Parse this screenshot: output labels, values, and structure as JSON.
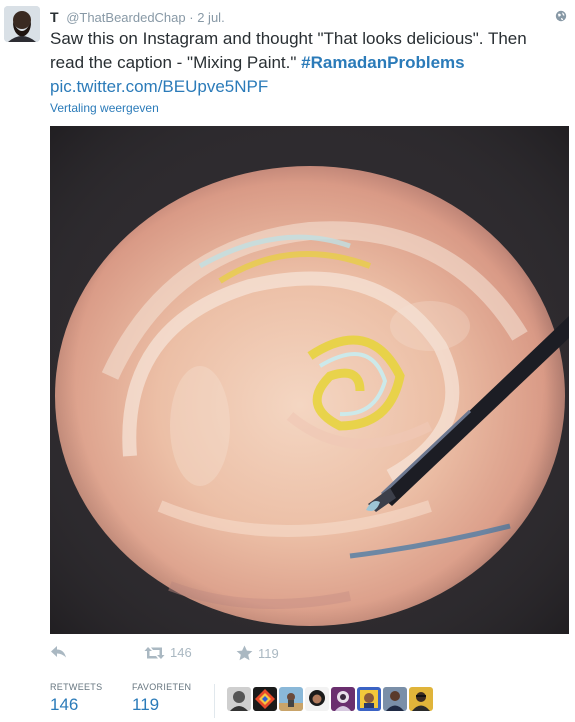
{
  "tweet": {
    "name": "T",
    "handle": "@ThatBeardedChap",
    "separator": "·",
    "date": "2 jul.",
    "text_main": "Saw this on Instagram and thought \"That looks delicious\". Then read the caption - \"Mixing Paint.\"",
    "hashtag": "#RamadanProblems",
    "link": "pic.twitter.com/BEUpve5NPF",
    "translate_label": "Vertaling weergeven"
  },
  "actions": {
    "reply_icon": "reply-icon",
    "retweet_icon": "retweet-icon",
    "retweet_count": "146",
    "favorite_icon": "star-icon",
    "favorite_count": "119"
  },
  "stats": {
    "retweets_label": "RETWEETS",
    "retweets_value": "146",
    "favorites_label": "FAVORIETEN",
    "favorites_value": "119"
  },
  "colors": {
    "link": "#2b7bb9",
    "text": "#292f33",
    "muted": "#8899a6",
    "icon": "#aab8c2"
  }
}
